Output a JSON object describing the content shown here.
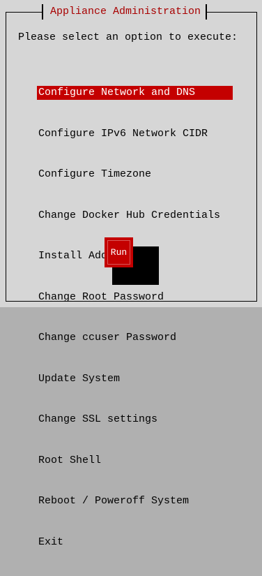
{
  "dialog": {
    "title": "Appliance Administration",
    "prompt": "Please select an option to execute:",
    "menu": [
      {
        "label": "Configure Network and DNS",
        "selected": true
      },
      {
        "label": "Configure IPv6 Network CIDR",
        "selected": false
      },
      {
        "label": "Configure Timezone",
        "selected": false
      },
      {
        "label": "Change Docker Hub Credentials",
        "selected": false
      },
      {
        "label": "Install Add-ons",
        "selected": false
      },
      {
        "label": "Change Root Password",
        "selected": false
      },
      {
        "label": "Change ccuser Password",
        "selected": false
      },
      {
        "label": "Update System",
        "selected": false
      },
      {
        "label": "Change SSL settings",
        "selected": false
      },
      {
        "label": "Root Shell",
        "selected": false
      },
      {
        "label": "Reboot / Poweroff System",
        "selected": false
      },
      {
        "label": "Exit",
        "selected": false
      }
    ],
    "run_button": "Run"
  },
  "colors": {
    "background": "#d6d6d6",
    "accent": "#c40000",
    "title_text": "#a80000",
    "text": "#000000",
    "selected_text": "#ffffff"
  }
}
